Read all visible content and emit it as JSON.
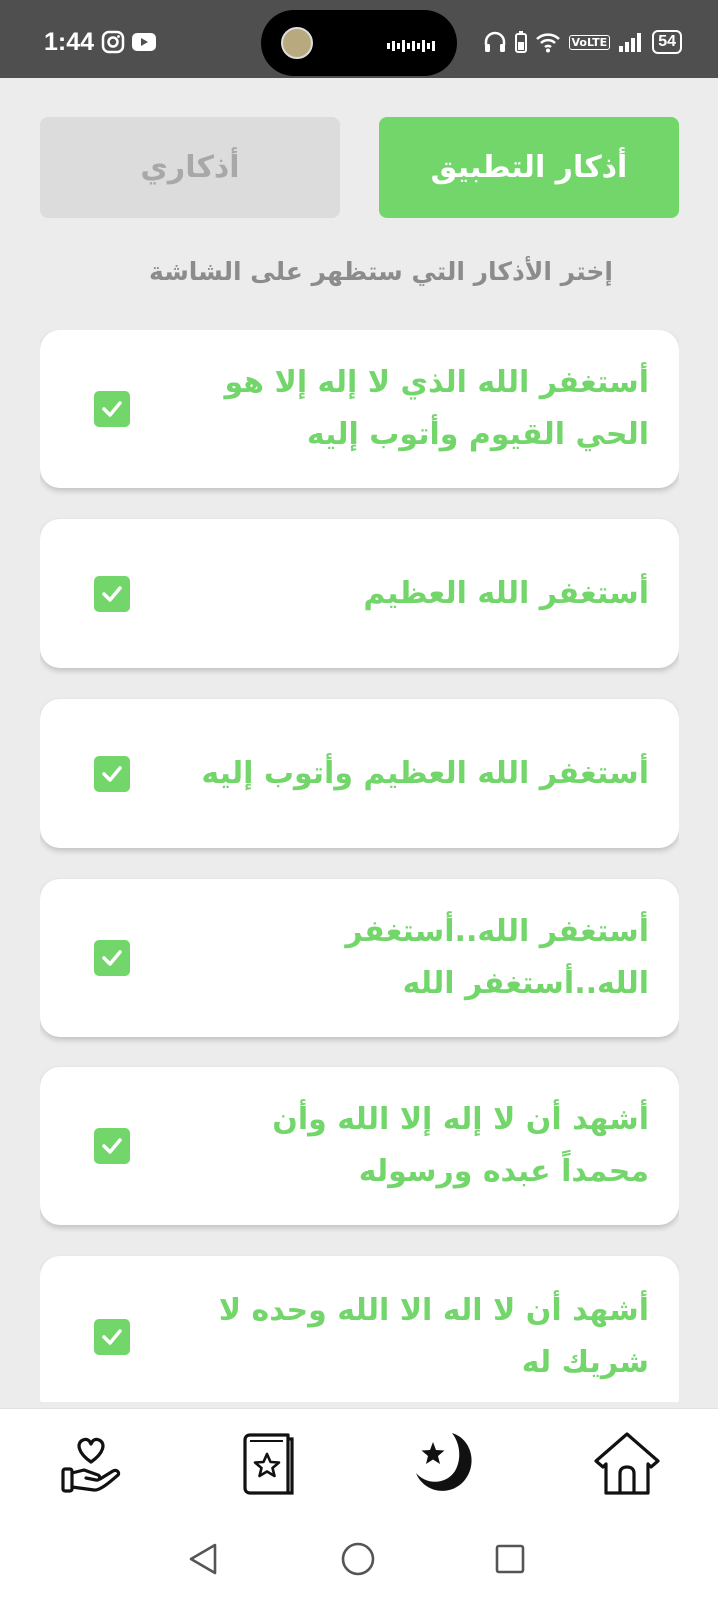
{
  "status": {
    "time": "1:44",
    "battery": "54",
    "network": "VoLTE"
  },
  "tabs": {
    "app_azkar": "أذكار التطبيق",
    "my_azkar": "أذكاري"
  },
  "instruction": "إختر الأذكار التي ستظهر على الشاشة",
  "azkar": [
    {
      "text": "أستغفر الله الذي لا إله إلا هو الحي القيوم وأتوب إليه",
      "checked": true
    },
    {
      "text": "أستغفر الله العظيم",
      "checked": true
    },
    {
      "text": "أستغفر الله العظيم وأتوب إليه",
      "checked": true
    },
    {
      "text": "أستغفر الله..أستغفر الله..أستغفر الله",
      "checked": true
    },
    {
      "text": "أشهد أن لا إله إلا الله وأن محمداً عبده ورسوله",
      "checked": true
    },
    {
      "text": "أشهد أن لا اله الا الله وحده لا شريك له",
      "checked": true
    }
  ],
  "bottom_nav": {
    "items": [
      {
        "icon": "heart-hand-icon"
      },
      {
        "icon": "star-book-icon"
      },
      {
        "icon": "moon-star-icon"
      },
      {
        "icon": "home-icon"
      }
    ]
  },
  "system_nav": {
    "icons": [
      "back-icon",
      "home-circle-icon",
      "recents-icon"
    ]
  },
  "colors": {
    "accent": "#72d66b",
    "inactive_tab": "#dcdcdc",
    "background": "#ececec"
  }
}
